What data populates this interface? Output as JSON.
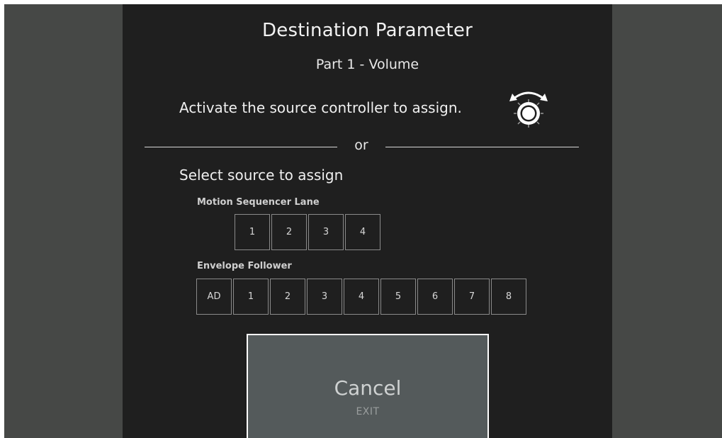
{
  "dialog": {
    "title": "Destination Parameter",
    "subtitle": "Part 1 - Volume",
    "instruction": "Activate the source controller to assign.",
    "instruction_icon": "rotary-knob-icon",
    "divider_text": "or",
    "select_heading": "Select source to assign",
    "motion_sequencer": {
      "label": "Motion Sequencer Lane",
      "buttons": [
        "1",
        "2",
        "3",
        "4"
      ]
    },
    "envelope_follower": {
      "label": "Envelope Follower",
      "buttons": [
        "AD",
        "1",
        "2",
        "3",
        "4",
        "5",
        "6",
        "7",
        "8"
      ]
    },
    "cancel": {
      "label": "Cancel",
      "sublabel": "EXIT"
    }
  },
  "colors": {
    "frame_background": "#464846",
    "dialog_background": "#1f1f1f",
    "button_border": "#8a8a8a",
    "cancel_background": "#545a5b",
    "cancel_border": "#ffffff"
  }
}
